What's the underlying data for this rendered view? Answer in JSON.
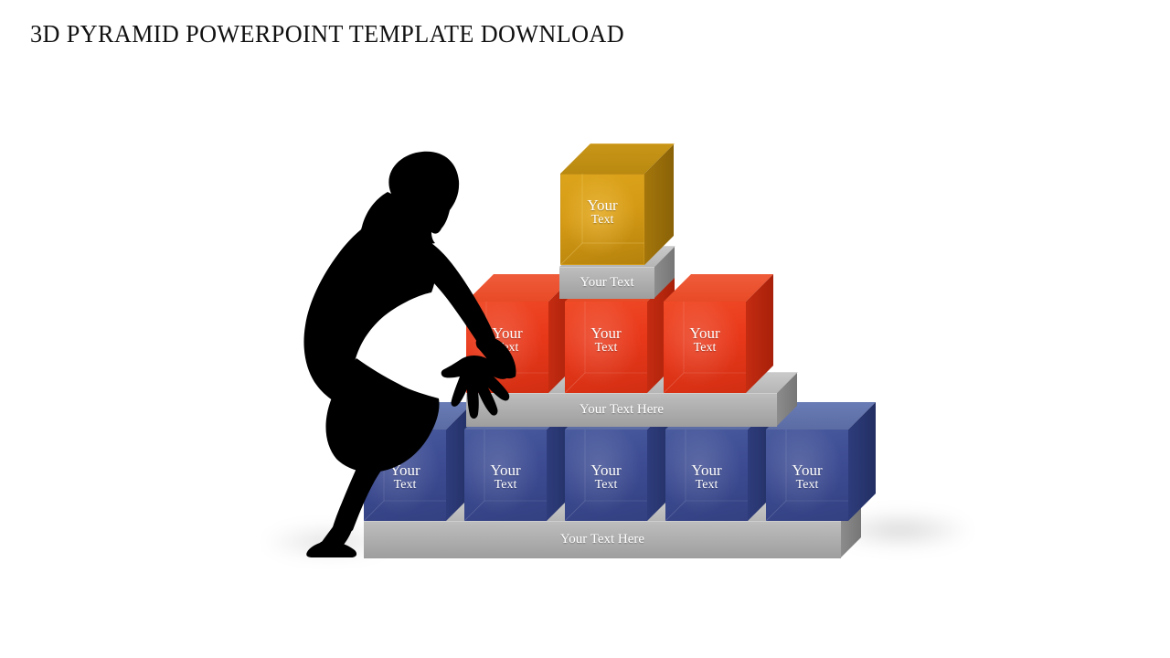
{
  "slide": {
    "title": "3D PYRAMID POWERPOINT TEMPLATE DOWNLOAD",
    "background_color": "#FFFFFF",
    "title_color": "#111111"
  },
  "palette": {
    "gold_front": "#D59A15",
    "gold_top": "#C79412",
    "gold_right": "#9C6F08",
    "red_front": "#E8381A",
    "red_top": "#E14828",
    "red_right": "#B5240C",
    "blue_front": "#3C4B92",
    "blue_top": "#5567A6",
    "blue_right": "#26356F",
    "gray_front": "#ADADAD",
    "gray_top": "#C3C3C3",
    "gray_right": "#7E7E7E",
    "silhouette": "#000000",
    "label_text": "#FFFFFF"
  },
  "figure": {
    "name": "businesswoman-silhouette",
    "description": "crouching woman in dress and high heels reaching toward red block"
  },
  "pyramid": {
    "levels": [
      {
        "id": "level-top",
        "tier": 1,
        "color_name": "gold",
        "blocks": [
          {
            "line1": "Your",
            "line2": "Text"
          }
        ],
        "slab": {
          "label": "Your Text"
        }
      },
      {
        "id": "level-middle",
        "tier": 2,
        "color_name": "red",
        "blocks": [
          {
            "line1": "Your",
            "line2": "Text"
          },
          {
            "line1": "Your",
            "line2": "Text"
          },
          {
            "line1": "Your",
            "line2": "Text"
          }
        ],
        "slab": {
          "label": "Your Text Here"
        }
      },
      {
        "id": "level-bottom",
        "tier": 3,
        "color_name": "blue",
        "blocks": [
          {
            "line1": "Your",
            "line2": "Text"
          },
          {
            "line1": "Your",
            "line2": "Text"
          },
          {
            "line1": "Your",
            "line2": "Text"
          },
          {
            "line1": "Your",
            "line2": "Text"
          },
          {
            "line1": "Your",
            "line2": "Text"
          }
        ],
        "slab": {
          "label": "Your Text Here"
        }
      }
    ]
  }
}
